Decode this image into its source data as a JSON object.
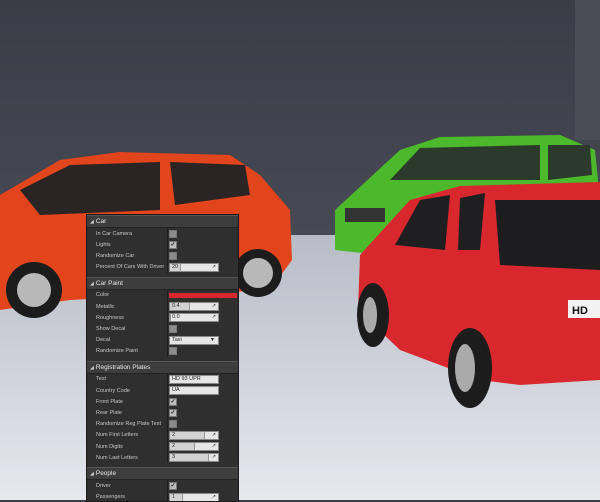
{
  "panel": {
    "sections": [
      {
        "title": "Car",
        "rows": [
          {
            "label": "In Car Camera",
            "type": "checkbox",
            "checked": false
          },
          {
            "label": "Lights",
            "type": "checkbox",
            "checked": true
          },
          {
            "label": "Randomize Car",
            "type": "checkbox",
            "checked": false
          },
          {
            "label": "Percent Of Cars With Driver",
            "type": "number",
            "value": "20",
            "fill": 0.2
          }
        ]
      },
      {
        "title": "Car Paint",
        "rows": [
          {
            "label": "Color",
            "type": "color",
            "value": "#d8282e"
          },
          {
            "label": "Metallic",
            "type": "number",
            "value": "0.4",
            "fill": 0.4
          },
          {
            "label": "Roughness",
            "type": "number",
            "value": "0.0",
            "fill": 0.0
          },
          {
            "label": "Show Decal",
            "type": "checkbox",
            "checked": false
          },
          {
            "label": "Decal",
            "type": "dropdown",
            "value": "Taxi"
          },
          {
            "label": "Randomize Paint",
            "type": "checkbox",
            "checked": false
          }
        ]
      },
      {
        "title": "Registration Plates",
        "rows": [
          {
            "label": "Text",
            "type": "text",
            "value": "HD 93 UPR"
          },
          {
            "label": "Country Code",
            "type": "text",
            "value": "UA"
          },
          {
            "label": "Front Plate",
            "type": "checkbox",
            "checked": true
          },
          {
            "label": "Rear Plate",
            "type": "checkbox",
            "checked": true
          },
          {
            "label": "Randomize Reg Plate Text",
            "type": "checkbox",
            "checked": false
          },
          {
            "label": "Num First Letters",
            "type": "number",
            "value": "2",
            "fill": 0.7
          },
          {
            "label": "Num Digits",
            "type": "number",
            "value": "2",
            "fill": 0.5
          },
          {
            "label": "Num Last Letters",
            "type": "number",
            "value": "3",
            "fill": 0.8
          }
        ]
      },
      {
        "title": "People",
        "rows": [
          {
            "label": "Driver",
            "type": "checkbox",
            "checked": true
          },
          {
            "label": "Passengers",
            "type": "number",
            "value": "1",
            "fill": 0.25
          }
        ]
      }
    ]
  },
  "scene": {
    "plate_text": "HD",
    "colors": {
      "orange_car": "#e2441c",
      "green_car": "#4cb82c",
      "red_car": "#d8282e"
    }
  }
}
